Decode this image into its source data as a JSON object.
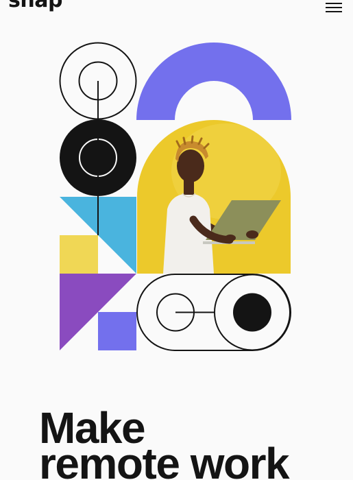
{
  "header": {
    "logo_text": "snap",
    "menu_icon": "hamburger-icon"
  },
  "hero": {
    "headline_line1": "Make",
    "headline_line2": "remote work"
  },
  "colors": {
    "background": "#fafafa",
    "text": "#141414",
    "violet": "#7370ed",
    "sky_blue": "#4ab4de",
    "yellow": "#f0d755",
    "purple": "#8a4bbf",
    "photo_yellow": "#ecc92b"
  },
  "illustration": {
    "photo_subject": "person-with-laptop"
  }
}
